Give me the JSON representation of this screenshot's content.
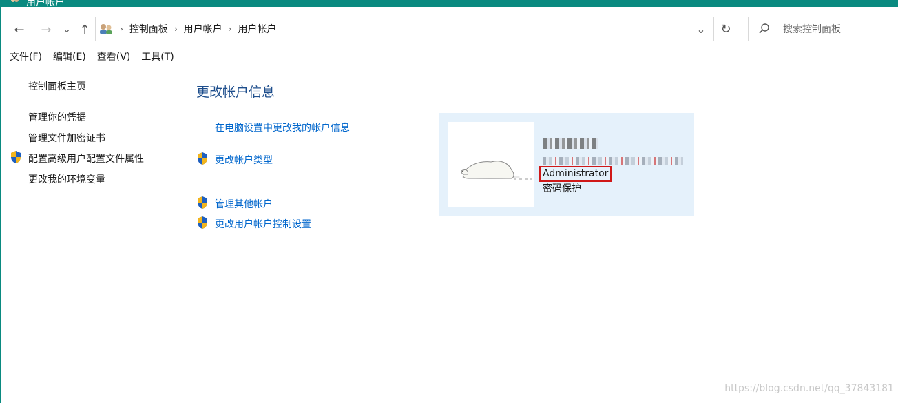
{
  "window": {
    "title": "用户帐户"
  },
  "nav": {
    "back_glyph": "←",
    "forward_glyph": "→",
    "recent_glyph": "⌄",
    "up_glyph": "↑",
    "breadcrumbs": [
      "控制面板",
      "用户帐户",
      "用户帐户"
    ],
    "breadcrumb_separator": "›",
    "dropdown_glyph": "⌄",
    "refresh_glyph": "↻"
  },
  "search": {
    "placeholder": "搜索控制面板",
    "value": ""
  },
  "menu": {
    "file": "文件(F)",
    "edit": "编辑(E)",
    "view": "查看(V)",
    "tools": "工具(T)"
  },
  "sidebar": {
    "home": "控制面板主页",
    "credentials": "管理你的凭据",
    "encryption": "管理文件加密证书",
    "profile": "配置高级用户配置文件属性",
    "environment": "更改我的环境变量"
  },
  "main": {
    "title": "更改帐户信息",
    "pc_settings_link": "在电脑设置中更改我的帐户信息",
    "change_type_link": "更改帐户类型",
    "manage_others_link": "管理其他帐户",
    "uac_settings_link": "更改用户帐户控制设置"
  },
  "account": {
    "role": "Administrator",
    "password_status": "密码保护"
  },
  "colors": {
    "titlebar": "#0a8a80",
    "link": "#0066cc",
    "heading": "#1e4e8c",
    "card_bg": "#e5f1fb",
    "highlight_box": "#d01818"
  },
  "icons": {
    "shield": "uac-shield-icon",
    "search": "search-icon",
    "folder": "users-folder-icon"
  },
  "watermark": "https://blog.csdn.net/qq_37843181"
}
